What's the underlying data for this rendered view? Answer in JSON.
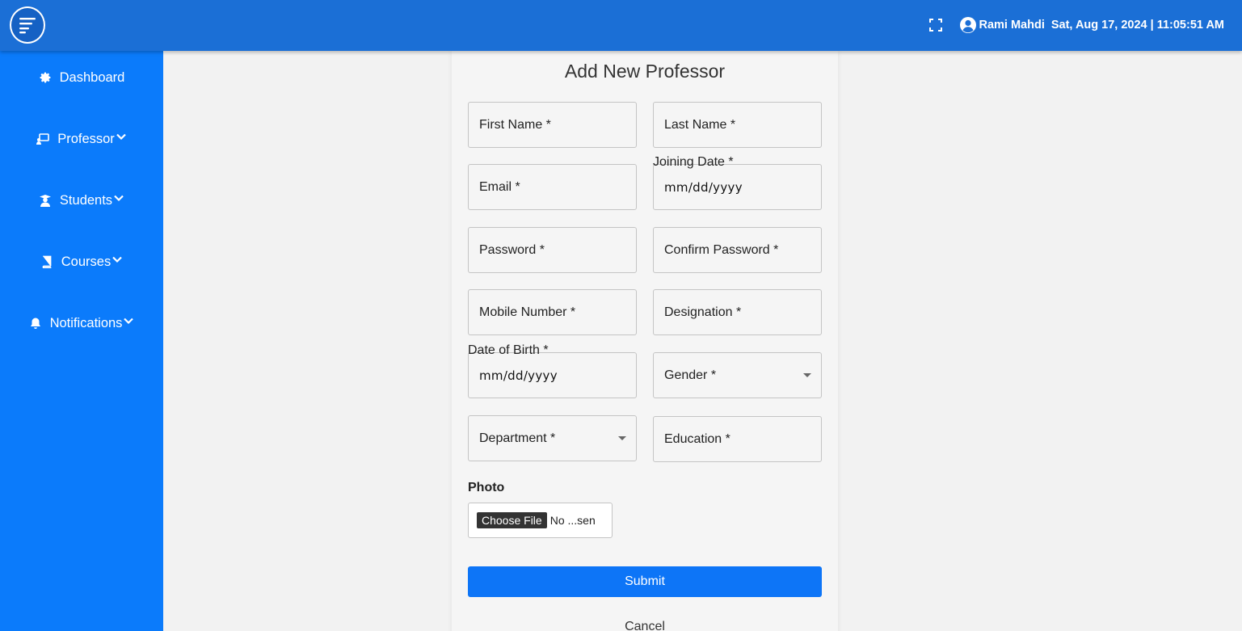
{
  "header": {
    "username": "Rami Mahdi",
    "datetime": "Sat, Aug 17, 2024 | 11:05:51 AM"
  },
  "sidebar": {
    "items": [
      {
        "label": "Dashboard",
        "icon": "gear-icon",
        "has_dropdown": false
      },
      {
        "label": "Professor",
        "icon": "chalkboard-teacher-icon",
        "has_dropdown": true
      },
      {
        "label": "Students",
        "icon": "graduate-icon",
        "has_dropdown": true
      },
      {
        "label": "Courses",
        "icon": "book-icon",
        "has_dropdown": true
      },
      {
        "label": "Notifications",
        "icon": "bell-icon",
        "has_dropdown": true
      }
    ]
  },
  "form": {
    "title": "Add New Professor",
    "first_name": "First Name *",
    "last_name": "Last Name *",
    "email": "Email *",
    "joining_date_label": "Joining Date *",
    "joining_date_placeholder": "mm/dd/yyyy",
    "password": "Password *",
    "confirm_password": "Confirm Password *",
    "mobile_number": "Mobile Number *",
    "designation": "Designation *",
    "dob_label": "Date of Birth *",
    "dob_placeholder": "mm/dd/yyyy",
    "gender": "Gender *",
    "department": "Department *",
    "education": "Education *",
    "photo_label": "Photo",
    "choose_file": "Choose File",
    "file_status": "No ...sen",
    "submit": "Submit",
    "cancel": "Cancel"
  },
  "colors": {
    "header_bg": "#1b6fd6",
    "sidebar_bg": "#0b7bfb",
    "submit_bg": "#0d75f7",
    "page_bg": "#f2f2f2"
  }
}
